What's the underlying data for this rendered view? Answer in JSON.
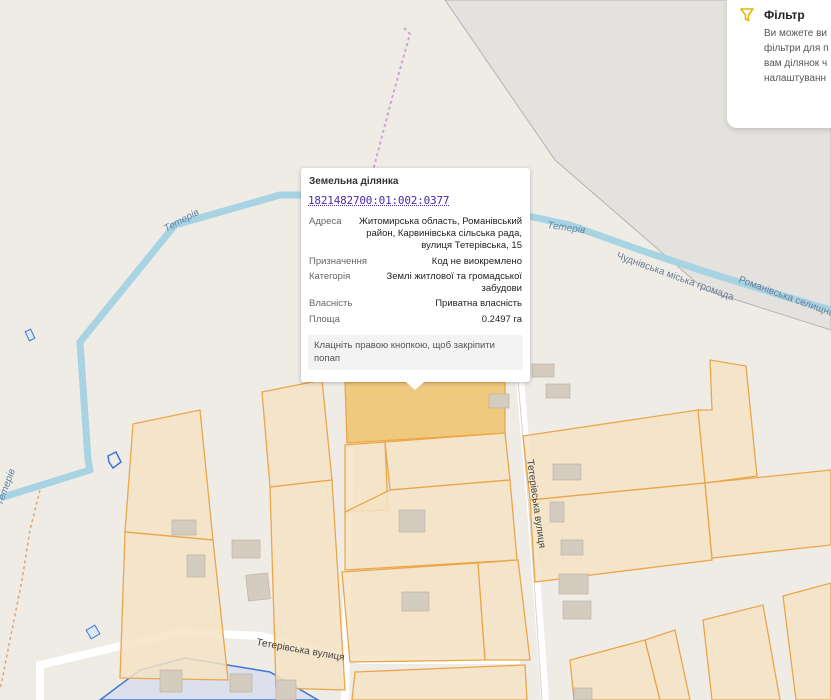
{
  "map": {
    "river_label_1": "Тетерів",
    "river_label_2": "Тетерів",
    "river_label_3": "Тетерів",
    "street_label_1": "Тетерівська вулиця",
    "street_label_2": "Тетерівська вулиця",
    "boundary_label_1": "Чуднівська міська громада",
    "boundary_label_2": "Романівська селищна"
  },
  "popup": {
    "title": "Земельна ділянка",
    "cadastral_number": "1821482700:01:002:0377",
    "address_label": "Адреса",
    "address_line1": "Житомирська область, Романівський",
    "address_line2": "район, Карвинівська сільська рада,",
    "address_line3": "вулиця Тетерівська, 15",
    "purpose_label": "Призначення",
    "purpose_value": "Код не виокремлено",
    "category_label": "Категорія",
    "category_line1": "Землі житлової та громадської",
    "category_line2": "забудови",
    "ownership_label": "Власність",
    "ownership_value": "Приватна власність",
    "area_label": "Площа",
    "area_value": "0.2497 га",
    "hint_line1": "Клацніть правою кнопкою, щоб закріпити",
    "hint_line2": "попап"
  },
  "filter": {
    "title": "Фільтр",
    "line1": "Ви можете ви",
    "line2": "фільтри для п",
    "line3": "вам ділянок ч",
    "line4": "налаштуванн"
  },
  "colors": {
    "background": "#efece6",
    "river": "#a8d3e3",
    "parcel_fill": "#f5e3c4",
    "parcel_stroke": "#eba64a",
    "parcel_selected": "#efc97e",
    "admin_boundary": "#c9a6d6",
    "cadastral_link": "#4b2aa3",
    "filter_icon": "#e8b200"
  }
}
